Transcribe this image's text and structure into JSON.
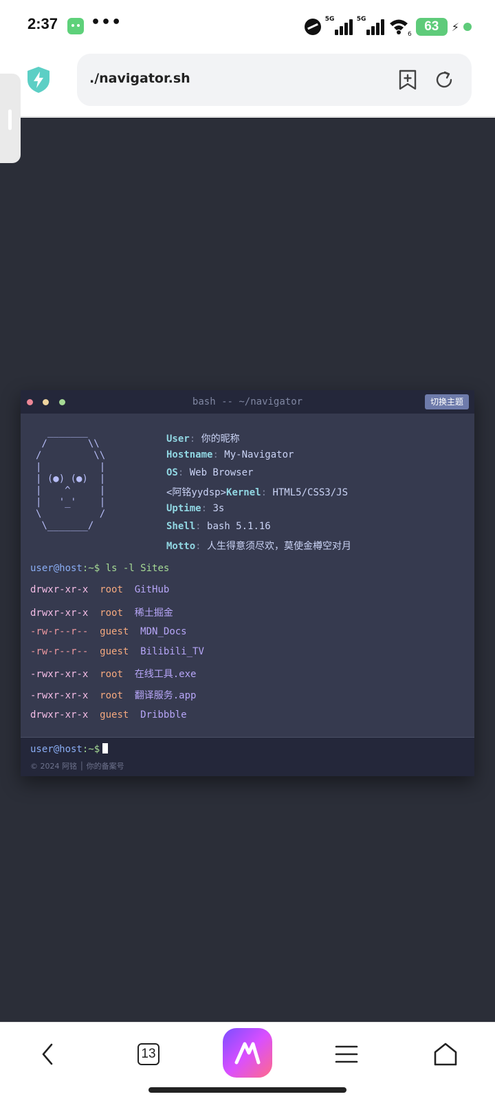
{
  "status_bar": {
    "time": "2:37",
    "more": "•••",
    "signal1_tag": "5G",
    "signal2_tag": "5G",
    "wifi_number": "6",
    "battery": "63"
  },
  "browser": {
    "url": "./navigator.sh"
  },
  "terminal": {
    "title": "bash -- ~/navigator",
    "theme_button": "切换主题",
    "ascii_art": [
      "  _______",
      " /       \\\\",
      "/         \\\\",
      "|          |",
      "| (●) (●)  |",
      "|    ^     |",
      "|   '_'    |",
      "\\          /",
      " \\_______/"
    ],
    "info": [
      {
        "prefix": "",
        "key": "User",
        "value": "你的昵称"
      },
      {
        "prefix": "",
        "key": "Hostname",
        "value": "My-Navigator"
      },
      {
        "prefix": "",
        "key": "OS",
        "value": "Web Browser"
      },
      {
        "prefix": "<阿铭yydsp>",
        "key": "Kernel",
        "value": "HTML5/CSS3/JS"
      },
      {
        "prefix": "",
        "key": "Uptime",
        "value": "3s"
      },
      {
        "prefix": "",
        "key": "Shell",
        "value": "bash 5.1.16"
      },
      {
        "prefix": "",
        "key": "Motto",
        "value": "人生得意须尽欢，莫使金樽空对月"
      }
    ],
    "prompt": {
      "user": "user@host",
      "path": ":~$",
      "command": " ls -l Sites"
    },
    "sites": [
      {
        "perm": "drwxr-xr-x",
        "owner": "root",
        "name": "GitHub"
      },
      {
        "perm": "drwxr-xr-x",
        "owner": "root",
        "name": "稀土掘金"
      },
      {
        "perm": "-rw-r--r--",
        "owner": "guest",
        "name": "MDN_Docs"
      },
      {
        "perm": "-rw-r--r--",
        "owner": "guest",
        "name": "Bilibili_TV"
      },
      {
        "perm": "-rwxr-xr-x",
        "owner": "root",
        "name": "在线工具.exe"
      },
      {
        "perm": "-rwxr-xr-x",
        "owner": "root",
        "name": "翻译服务.app"
      },
      {
        "perm": "drwxr-xr-x",
        "owner": "guest",
        "name": "Dribbble"
      }
    ],
    "footer": {
      "prompt_user": "user@host",
      "prompt_path": ":~$",
      "copyright": "© 2024 阿铭 │ 你的备案号"
    }
  },
  "bottom_nav": {
    "tab_count": "13"
  },
  "colors": {
    "page_background": "#2b2e38",
    "terminal_body": "#363a4f",
    "terminal_bar": "#24273a",
    "theme_button": "#6e7bab",
    "key": "#91d7e3",
    "permission": "#f5bde6",
    "owner": "#f5a97f",
    "site_name": "#b7a6f8"
  }
}
